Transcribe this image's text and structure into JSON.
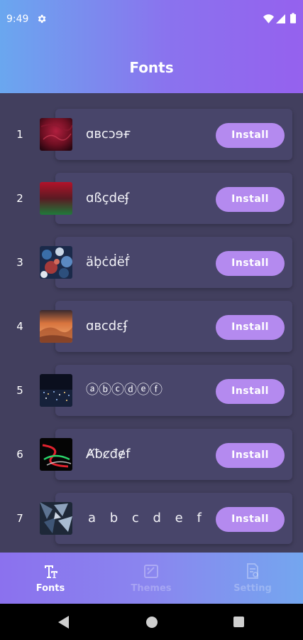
{
  "status_bar": {
    "time": "9:49"
  },
  "header": {
    "title": "Fonts"
  },
  "fonts": [
    {
      "index": "1",
      "sample": "ɑʙcɔɘғ",
      "button": "Install",
      "thumb": "red-texture"
    },
    {
      "index": "2",
      "sample": "ɑßçdeʄ",
      "button": "Install",
      "thumb": "red-green-gradient"
    },
    {
      "index": "3",
      "sample": "äḅċḋëḟ",
      "button": "Install",
      "thumb": "blue-rocks"
    },
    {
      "index": "4",
      "sample": "ɑʙcdɛʄ",
      "button": "Install",
      "thumb": "orange-desert"
    },
    {
      "index": "5",
      "sample": "ⓐⓑⓒⓓⓔⓕ",
      "button": "Install",
      "thumb": "night-city"
    },
    {
      "index": "6",
      "sample": "Ⱥƀȼđɇf",
      "button": "Install",
      "thumb": "neon-lights"
    },
    {
      "index": "7",
      "sample": "a b c d e f",
      "button": "Install",
      "thumb": "blue-mosaic"
    }
  ],
  "bottom_nav": {
    "items": [
      {
        "label": "Fonts",
        "icon": "text-fonts-icon",
        "active": true
      },
      {
        "label": "Themes",
        "icon": "palette-icon",
        "active": false
      },
      {
        "label": "Setting",
        "icon": "settings-document-icon",
        "active": false
      }
    ]
  },
  "colors": {
    "header_start": "#6aa7ef",
    "header_end": "#9561ee",
    "content_bg": "#423f5e",
    "card_bg": "#48456a",
    "install_button": "#b48aef"
  }
}
